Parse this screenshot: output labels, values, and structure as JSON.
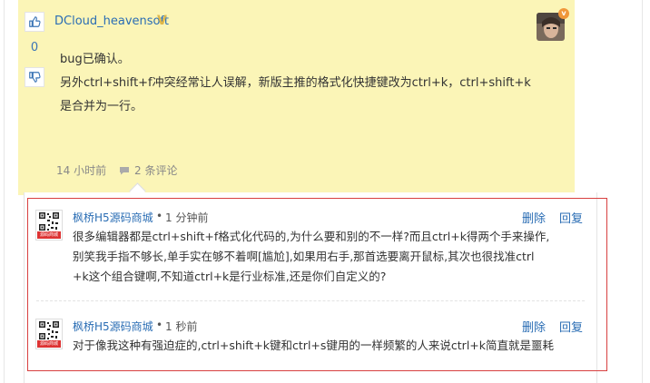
{
  "answer": {
    "author": "DCloud_heavensoft",
    "author_badge": "V",
    "avatar_badge": "v",
    "vote_count": "0",
    "body_lines": [
      "bug已确认。",
      "另外ctrl+shift+f冲突经常让人误解，新版主推的格式化快捷键改为ctrl+k，ctrl+shift+k",
      "是合并为一行。"
    ],
    "time": "14 小时前",
    "comments_count": "2 条评论"
  },
  "comments": [
    {
      "author": "枫桥H5源码商城",
      "sep": "•",
      "time": "1 分钟前",
      "avatar_tag": "源码商城",
      "delete_label": "删除",
      "reply_label": "回复",
      "lines": [
        "很多编辑器都是ctrl+shift+f格式化代码的,为什么要和别的不一样?而且ctrl+k得两个手来操作,",
        "别笑我手指不够长,单手实在够不着啊[尴尬],如果用右手,那首选要离开鼠标,其次也很找准ctrl",
        "+k这个组合键啊,不知道ctrl+k是行业标准,还是你们自定义的?"
      ]
    },
    {
      "author": "枫桥H5源码商城",
      "sep": "•",
      "time": "1 秒前",
      "avatar_tag": "源码商城",
      "delete_label": "删除",
      "reply_label": "回复",
      "lines": [
        "对于像我这种有强迫症的,ctrl+shift+k键和ctrl+s键用的一样频繁的人来说ctrl+k简直就是噩耗"
      ]
    }
  ],
  "icons": {
    "upvote": "thumbs-up-icon",
    "downvote": "thumbs-down-icon",
    "comment": "speech-bubble-icon"
  },
  "colors": {
    "answer_bg": "#fbf5b7",
    "link": "#2a6db4",
    "highlight_border": "#d84040"
  }
}
